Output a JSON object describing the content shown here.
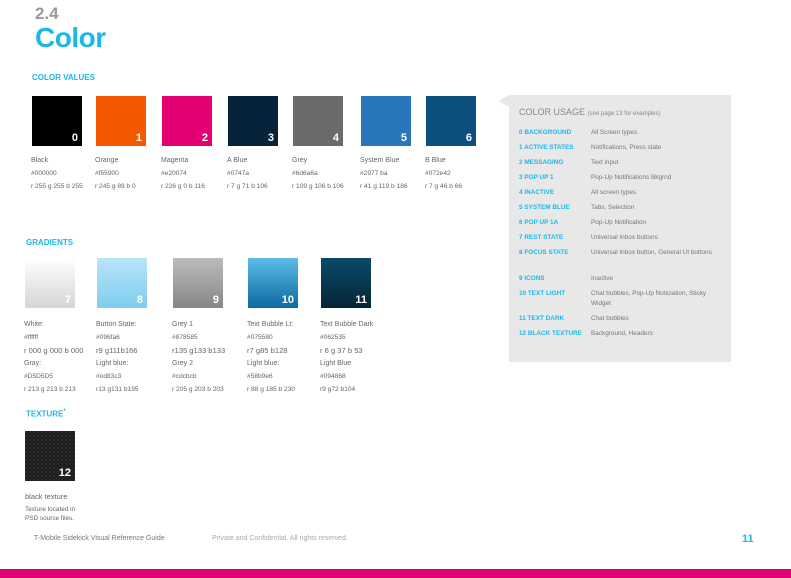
{
  "section_number": "2.4",
  "section_title": "Color",
  "color_values_heading": "COLOR VALUES",
  "gradients_heading": "GRADIENTS",
  "texture_heading": "TEXTURE",
  "texture_marker": "*",
  "colors": [
    {
      "num": "0",
      "name": "Black",
      "hex": "#000000",
      "rgb": "r 255 g 255 b 255",
      "swatch": "#000000"
    },
    {
      "num": "1",
      "name": "Orange",
      "hex": "#f55900",
      "rgb": "r 245 g 89 b 0",
      "swatch": "#f55900"
    },
    {
      "num": "2",
      "name": "Magenta",
      "hex": "#e20074",
      "rgb": "r 226 g 0 b 116",
      "swatch": "#e20074"
    },
    {
      "num": "3",
      "name": "A Blue",
      "hex": "#0747a",
      "rgb": "r 7 g 71 b 106",
      "swatch": "#07233a"
    },
    {
      "num": "4",
      "name": "Grey",
      "hex": "#6d6a6a",
      "rgb": "r 109 g 106 b 106",
      "swatch": "#6d6a6a"
    },
    {
      "num": "5",
      "name": "System Blue",
      "hex": "#2977 ba",
      "rgb": "r 41 g 119 b 186",
      "swatch": "#2977ba"
    },
    {
      "num": "6",
      "name": "B Blue",
      "hex": "#072e42",
      "rgb": "r 7 g 46 b 66",
      "swatch": "#0b4f7e"
    }
  ],
  "gradients": [
    {
      "num": "7",
      "name": "White:",
      "hex": "#ffffff",
      "rgb": "r 000 g 000 b 000",
      "name2": "Gray:",
      "hex2": "#D5D5D5",
      "rgb2": "r 213 g 213 b 213",
      "from": "#ffffff",
      "to": "#d5d5d5"
    },
    {
      "num": "8",
      "name": "Button State:",
      "hex": "#096fa6",
      "rgb": "r9 g111b166",
      "name2": "Light blue:",
      "hex2": "#od83c3",
      "rgb2": "r13 g131 b195",
      "from": "#b9e4f8",
      "to": "#7fcdef"
    },
    {
      "num": "9",
      "name": "Grey 1",
      "hex": "#878585",
      "rgb": "r135 g133 b133",
      "name2": "Grey 2",
      "hex2": "#cdcbcb",
      "rgb2": "r 205 g 203 b 203",
      "from": "#bdbbbb",
      "to": "#878585"
    },
    {
      "num": "10",
      "name": "Text Bubble Lt:",
      "hex": "#075580",
      "rgb": "r7 g85 b128",
      "name2": "Light blue:",
      "hex2": "#58b9e6",
      "rgb2": "r 88 g 185 b 230",
      "from": "#5dbde8",
      "to": "#0b6aa0"
    },
    {
      "num": "11",
      "name": "Text Bubble Dark",
      "hex": "#062535",
      "rgb": "r 6 g 37 b 53",
      "name2": "Light Blue",
      "hex2": "#094868",
      "rgb2": "r9 g72 b104",
      "from": "#0a4a6a",
      "to": "#062535"
    }
  ],
  "texture": {
    "num": "12",
    "name": "black texture",
    "note_line1": "Texture located in",
    "note_line2": "PSD source files."
  },
  "usage": {
    "title": "COLOR USAGE",
    "title_note": "(see page 13 for examples)",
    "rows": [
      {
        "key": "0 BACKGROUND",
        "value": "All Screen types"
      },
      {
        "key": "1 ACTIVE STATES",
        "value": "Notifications, Press state"
      },
      {
        "key": "2 MESSAGING",
        "value": "Text input"
      },
      {
        "key": "3 POP UP 1",
        "value": "Pop-Up Notifications Bkgrnd"
      },
      {
        "key": "4 INACTIVE",
        "value": "All screen types"
      },
      {
        "key": "5 SYSTEM BLUE",
        "value": "Tabs, Selection"
      },
      {
        "key": "6 POP UP 1A",
        "value": "Pop-Up Notification"
      },
      {
        "key": "7 REST STATE",
        "value": "Universal Inbox buttons"
      },
      {
        "key": "8 FOCUS STATE",
        "value": "Universal Inbox button, General UI buttons"
      },
      {
        "key": "9 ICONS",
        "value": "Inactive"
      },
      {
        "key": "10 TEXT LIGHT",
        "value": "Chat bubbles, Pop-Up Noticiation, Sticky Widget"
      },
      {
        "key": "11 TEXT DARK",
        "value": "Chat bubbles"
      },
      {
        "key": "12 BLACK TEXTURE",
        "value": "Background, Headers"
      }
    ]
  },
  "footer": {
    "guide_title": "T-Mobile Sidekick Visual Reference Guide",
    "confidential": "Private and Confidential. All rights reserved.",
    "page_number": "11"
  },
  "accent_colors": {
    "cyan": "#1bb8e8",
    "magenta": "#e20074"
  }
}
